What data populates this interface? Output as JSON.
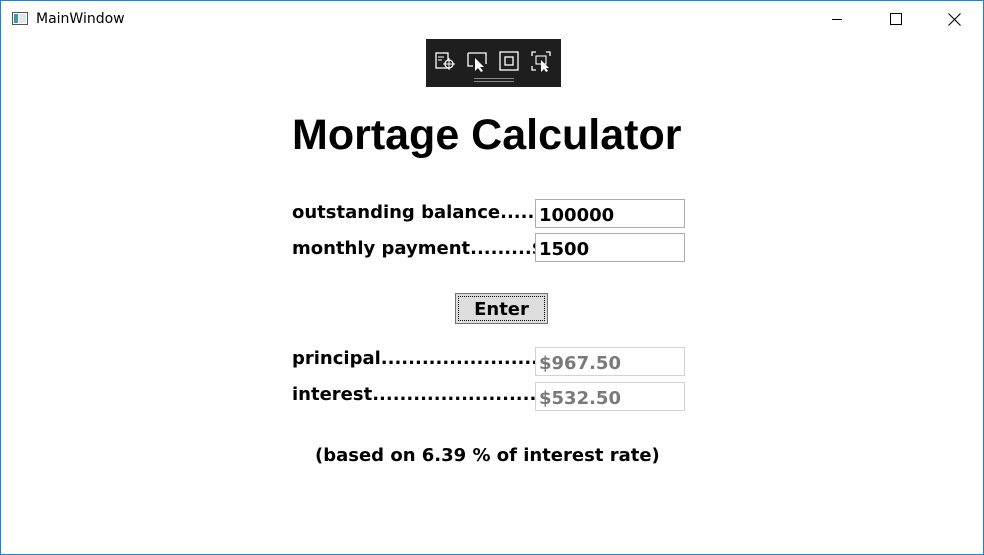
{
  "window": {
    "title": "MainWindow"
  },
  "devtools": {
    "buttons": [
      "select-element-icon",
      "cursor-select-icon",
      "layout-adorner-icon",
      "track-focus-icon"
    ]
  },
  "main": {
    "heading": "Mortage Calculator",
    "inputs": {
      "balance_label": "outstanding balance.....$",
      "balance_value": "100000",
      "payment_label": "monthly payment.........$",
      "payment_value": "1500"
    },
    "enter_label": "Enter",
    "results": {
      "principal_label": "principal..........................",
      "principal_value": "$967.50",
      "interest_label": "interest............................",
      "interest_value": "$532.50"
    },
    "note": "(based on 6.39 % of interest rate)"
  },
  "colors": {
    "window_border": "#1883d7",
    "devbar_bg": "#1e1e1e",
    "readonly_text": "#7a7a7a"
  }
}
